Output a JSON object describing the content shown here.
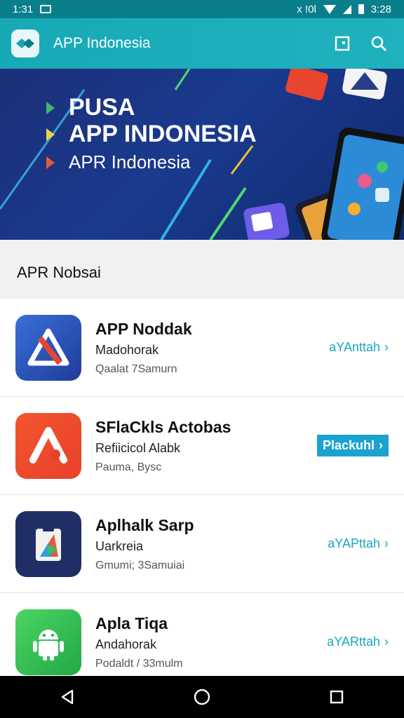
{
  "status_bar": {
    "time_left": "1:31",
    "time_right": "3:28",
    "extra": "x !0l"
  },
  "app_bar": {
    "title": "APP Indonesia"
  },
  "banner": {
    "line1": "PUSA",
    "line2": "APP INDONESIA",
    "line3": "APR Indonesia",
    "colors": {
      "tri1": "#3fb86b",
      "tri2": "#e8d24a",
      "tri3": "#e8573a"
    }
  },
  "section": {
    "title": "APR Nobsai"
  },
  "apps": [
    {
      "name": "APP Noddak",
      "developer": "Madohorak",
      "meta": "Qaalat 7Samurn",
      "action": "aYAnttah",
      "filled": false,
      "icon": "triangle-app-icon"
    },
    {
      "name": "SFlaCkls Actobas",
      "developer": "Refiicicol Alabk",
      "meta": "Pauma, Bysc",
      "action": "Plackuhl",
      "filled": true,
      "icon": "chevron-app-icon"
    },
    {
      "name": "Aplhalk Sarp",
      "developer": "Uarkreia",
      "meta": "Gmumi; 3Samuiai",
      "action": "aYAPttah",
      "filled": false,
      "icon": "clipboard-app-icon"
    },
    {
      "name": "Apla Tiqa",
      "developer": "Andahorak",
      "meta": "Podaldt / 33mulm",
      "action": "aYARttah",
      "filled": false,
      "icon": "android-app-icon"
    }
  ]
}
